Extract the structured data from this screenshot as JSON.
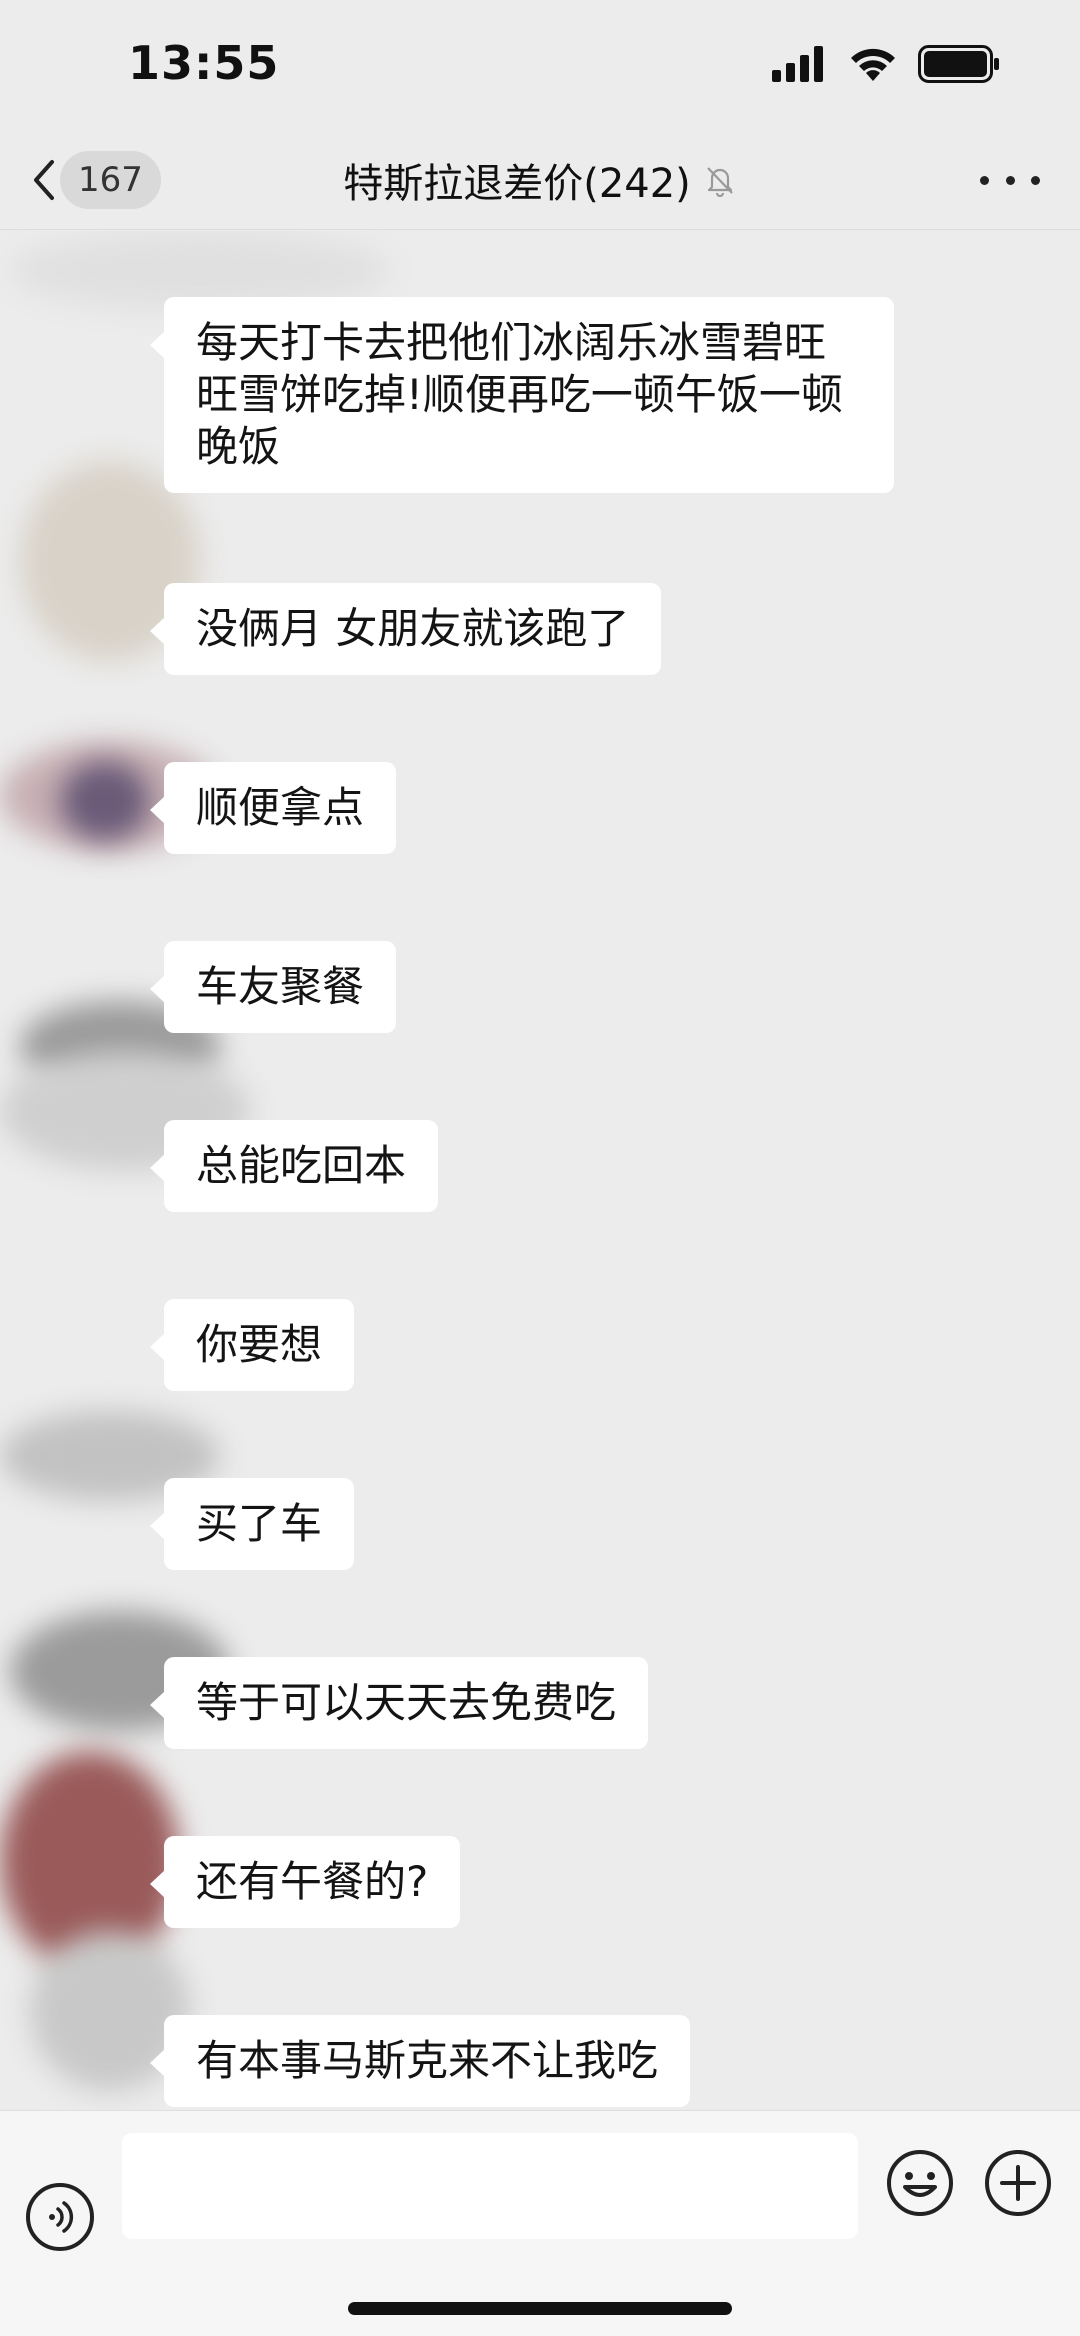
{
  "status_bar": {
    "time": "13:55"
  },
  "header": {
    "back_count": "167",
    "title": "特斯拉退差价(242)"
  },
  "messages": [
    {
      "line1": "每天打卡去把他们冰阔乐冰雪碧旺",
      "line2": "旺雪饼吃掉!顺便再吃一顿午饭一顿",
      "line3": "晚饭"
    },
    {
      "text": "没俩月  女朋友就该跑了"
    },
    {
      "text": "顺便拿点"
    },
    {
      "text": "车友聚餐"
    },
    {
      "text": "总能吃回本"
    },
    {
      "text": "你要想"
    },
    {
      "text": "买了车"
    },
    {
      "text": "等于可以天天去免费吃"
    },
    {
      "text": "还有午餐的?"
    },
    {
      "text": "有本事马斯克来不让我吃"
    }
  ],
  "icons": {
    "signal": "signal-icon",
    "wifi": "wifi-icon",
    "battery": "battery-icon",
    "mute": "mute-bell-icon",
    "back": "chevron-left-icon",
    "more": "more-dots-icon",
    "voice": "voice-icon",
    "emoji": "emoji-icon",
    "plus": "plus-icon"
  }
}
